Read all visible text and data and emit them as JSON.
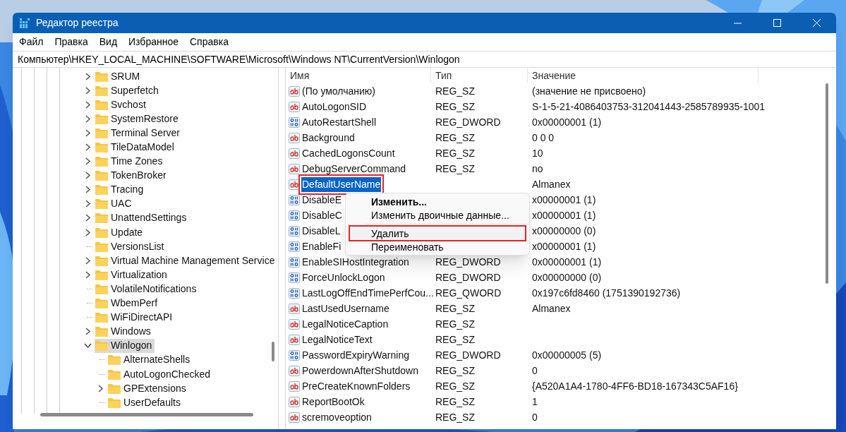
{
  "window": {
    "title": "Редактор реестра"
  },
  "menu": [
    "Файл",
    "Правка",
    "Вид",
    "Избранное",
    "Справка"
  ],
  "address": "Компьютер\\HKEY_LOCAL_MACHINE\\SOFTWARE\\Microsoft\\Windows NT\\CurrentVersion\\Winlogon",
  "tree": [
    {
      "label": "SRUM",
      "expanded": false,
      "selected": false
    },
    {
      "label": "Superfetch",
      "expanded": false,
      "selected": false
    },
    {
      "label": "Svchost",
      "expanded": false,
      "selected": false
    },
    {
      "label": "SystemRestore",
      "expanded": false,
      "selected": false
    },
    {
      "label": "Terminal Server",
      "expanded": false,
      "selected": false
    },
    {
      "label": "TileDataModel",
      "expanded": false,
      "selected": false
    },
    {
      "label": "Time Zones",
      "expanded": false,
      "selected": false
    },
    {
      "label": "TokenBroker",
      "expanded": false,
      "selected": false
    },
    {
      "label": "Tracing",
      "expanded": false,
      "selected": false
    },
    {
      "label": "UAC",
      "expanded": false,
      "selected": false
    },
    {
      "label": "UnattendSettings",
      "expanded": false,
      "selected": false
    },
    {
      "label": "Update",
      "expanded": false,
      "selected": false
    },
    {
      "label": "VersionsList",
      "selected": false
    },
    {
      "label": "Virtual Machine Management Service",
      "expanded": false,
      "selected": false
    },
    {
      "label": "Virtualization",
      "expanded": false,
      "selected": false
    },
    {
      "label": "VolatileNotifications",
      "selected": false
    },
    {
      "label": "WbemPerf",
      "selected": false
    },
    {
      "label": "WiFiDirectAPI",
      "selected": false
    },
    {
      "label": "Windows",
      "expanded": false,
      "selected": false
    },
    {
      "label": "Winlogon",
      "expanded": true,
      "selected": true,
      "children": [
        {
          "label": "AlternateShells",
          "selected": false
        },
        {
          "label": "AutoLogonChecked",
          "selected": false
        },
        {
          "label": "GPExtensions",
          "expanded": false,
          "selected": false
        },
        {
          "label": "UserDefaults",
          "selected": false
        }
      ]
    }
  ],
  "table": {
    "columns": [
      "Имя",
      "Тип",
      "Значение"
    ],
    "rows": [
      {
        "kind": "string",
        "name": "(По умолчанию)",
        "type": "REG_SZ",
        "value": "(значение не присвоено)",
        "selected": false,
        "highlighted": false
      },
      {
        "kind": "string",
        "name": "AutoLogonSID",
        "type": "REG_SZ",
        "value": "S-1-5-21-4086403753-312041443-2585789935-1001",
        "selected": false,
        "highlighted": false
      },
      {
        "kind": "number",
        "name": "AutoRestartShell",
        "type": "REG_DWORD",
        "value": "0x00000001 (1)",
        "selected": false,
        "highlighted": false
      },
      {
        "kind": "string",
        "name": "Background",
        "type": "REG_SZ",
        "value": "0 0 0",
        "selected": false,
        "highlighted": false
      },
      {
        "kind": "string",
        "name": "CachedLogonsCount",
        "type": "REG_SZ",
        "value": "10",
        "selected": false,
        "highlighted": false
      },
      {
        "kind": "string",
        "name": "DebugServerCommand",
        "type": "REG_SZ",
        "value": "no",
        "selected": false,
        "highlighted": false
      },
      {
        "kind": "string",
        "name": "DefaultUserName",
        "value": "Almanex",
        "selected": true,
        "highlighted": true
      },
      {
        "kind": "number",
        "name": "DisableE",
        "value": "x00000001 (1)",
        "selected": false,
        "highlighted": false
      },
      {
        "kind": "number",
        "name": "DisableC",
        "value": "x00000001 (1)",
        "selected": false,
        "highlighted": false
      },
      {
        "kind": "number",
        "name": "DisableL",
        "value": "x00000000 (0)",
        "selected": false,
        "highlighted": false
      },
      {
        "kind": "number",
        "name": "EnableFi",
        "value": "x00000001 (1)",
        "selected": false,
        "highlighted": false
      },
      {
        "kind": "number",
        "name": "EnableSIHostIntegration",
        "type": "REG_DWORD",
        "value": "0x00000001 (1)",
        "selected": false,
        "highlighted": false
      },
      {
        "kind": "number",
        "name": "ForceUnlockLogon",
        "type": "REG_DWORD",
        "value": "0x00000000 (0)",
        "selected": false,
        "highlighted": false
      },
      {
        "kind": "number",
        "name": "LastLogOffEndTimePerfCou...",
        "type": "REG_QWORD",
        "value": "0x197c6fd8460 (1751390192736)",
        "selected": false,
        "highlighted": false
      },
      {
        "kind": "string",
        "name": "LastUsedUsername",
        "type": "REG_SZ",
        "value": "Almanex",
        "selected": false,
        "highlighted": false
      },
      {
        "kind": "string",
        "name": "LegalNoticeCaption",
        "type": "REG_SZ",
        "selected": false,
        "highlighted": false
      },
      {
        "kind": "string",
        "name": "LegalNoticeText",
        "type": "REG_SZ",
        "selected": false,
        "highlighted": false
      },
      {
        "kind": "number",
        "name": "PasswordExpiryWarning",
        "type": "REG_DWORD",
        "value": "0x00000005 (5)",
        "selected": false,
        "highlighted": false
      },
      {
        "kind": "string",
        "name": "PowerdownAfterShutdown",
        "type": "REG_SZ",
        "value": "0",
        "selected": false,
        "highlighted": false
      },
      {
        "kind": "string",
        "name": "PreCreateKnownFolders",
        "type": "REG_SZ",
        "value": "{A520A1A4-1780-4FF6-BD18-167343C5AF16}",
        "selected": false,
        "highlighted": false
      },
      {
        "kind": "string",
        "name": "ReportBootOk",
        "type": "REG_SZ",
        "value": "1",
        "selected": false,
        "highlighted": false
      },
      {
        "kind": "string",
        "name": "scremoveoption",
        "type": "REG_SZ",
        "value": "0",
        "selected": false,
        "highlighted": false
      }
    ]
  },
  "context_menu": [
    {
      "label": "Изменить...",
      "bold": true,
      "highlighted": false
    },
    {
      "label": "Изменить двоичные данные...",
      "bold": false,
      "highlighted": false
    },
    {
      "kind": "separator"
    },
    {
      "label": "Удалить",
      "bold": false,
      "highlighted": true
    },
    {
      "label": "Переименовать",
      "bold": false,
      "highlighted": false
    }
  ]
}
